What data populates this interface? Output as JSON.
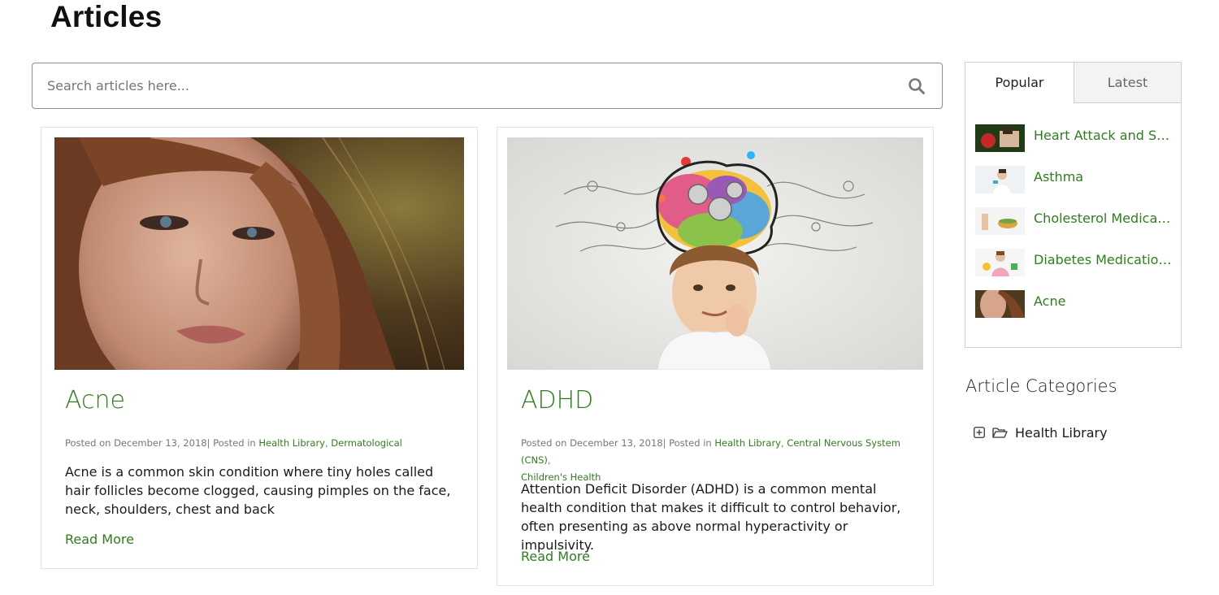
{
  "page": {
    "title": "Articles"
  },
  "search": {
    "placeholder": "Search articles here...",
    "icon": "search-icon"
  },
  "articles": [
    {
      "title": "Acne",
      "posted_prefix": "Posted on December 13, 2018",
      "posted_in_label": "| Posted in",
      "categories": [
        "Health Library",
        "Dermatological"
      ],
      "excerpt": "Acne is a common skin condition where tiny holes called hair follicles become clogged, causing pimples on the face, neck, shoulders, chest and back",
      "read_more": "Read More"
    },
    {
      "title": "ADHD",
      "posted_prefix": "Posted on December 13, 2018",
      "posted_in_label": "| Posted in",
      "categories": [
        "Health Library",
        "Central Nervous System (CNS)",
        "Children's Health"
      ],
      "excerpt": "Attention Deficit Disorder (ADHD) is a common mental health condition that makes it difficult to control behavior, often presenting as above normal hyperactivity or impulsivity.",
      "read_more": "Read More"
    }
  ],
  "sidebar": {
    "tabs": [
      {
        "label": "Popular",
        "active": true
      },
      {
        "label": "Latest",
        "active": false
      }
    ],
    "popular": [
      {
        "label": "Heart Attack and Str..."
      },
      {
        "label": "Asthma"
      },
      {
        "label": "Cholesterol Medicati..."
      },
      {
        "label": "Diabetes Medication ..."
      },
      {
        "label": "Acne"
      }
    ],
    "categories_heading": "Article Categories",
    "categories": [
      {
        "label": "Health Library",
        "icon": "folder-open-icon",
        "expand_icon": "plus-square-icon"
      }
    ]
  },
  "colors": {
    "link_green": "#2f7d1f",
    "border": "#e4e4e4"
  }
}
